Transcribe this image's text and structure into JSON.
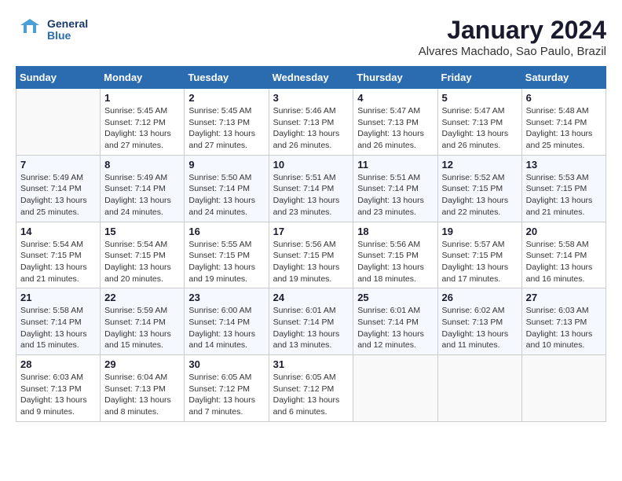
{
  "logo": {
    "line1": "General",
    "line2": "Blue"
  },
  "title": "January 2024",
  "location": "Alvares Machado, Sao Paulo, Brazil",
  "weekdays": [
    "Sunday",
    "Monday",
    "Tuesday",
    "Wednesday",
    "Thursday",
    "Friday",
    "Saturday"
  ],
  "weeks": [
    [
      {
        "day": "",
        "sunrise": "",
        "sunset": "",
        "daylight": ""
      },
      {
        "day": "1",
        "sunrise": "Sunrise: 5:45 AM",
        "sunset": "Sunset: 7:12 PM",
        "daylight": "Daylight: 13 hours and 27 minutes."
      },
      {
        "day": "2",
        "sunrise": "Sunrise: 5:45 AM",
        "sunset": "Sunset: 7:13 PM",
        "daylight": "Daylight: 13 hours and 27 minutes."
      },
      {
        "day": "3",
        "sunrise": "Sunrise: 5:46 AM",
        "sunset": "Sunset: 7:13 PM",
        "daylight": "Daylight: 13 hours and 26 minutes."
      },
      {
        "day": "4",
        "sunrise": "Sunrise: 5:47 AM",
        "sunset": "Sunset: 7:13 PM",
        "daylight": "Daylight: 13 hours and 26 minutes."
      },
      {
        "day": "5",
        "sunrise": "Sunrise: 5:47 AM",
        "sunset": "Sunset: 7:13 PM",
        "daylight": "Daylight: 13 hours and 26 minutes."
      },
      {
        "day": "6",
        "sunrise": "Sunrise: 5:48 AM",
        "sunset": "Sunset: 7:14 PM",
        "daylight": "Daylight: 13 hours and 25 minutes."
      }
    ],
    [
      {
        "day": "7",
        "sunrise": "Sunrise: 5:49 AM",
        "sunset": "Sunset: 7:14 PM",
        "daylight": "Daylight: 13 hours and 25 minutes."
      },
      {
        "day": "8",
        "sunrise": "Sunrise: 5:49 AM",
        "sunset": "Sunset: 7:14 PM",
        "daylight": "Daylight: 13 hours and 24 minutes."
      },
      {
        "day": "9",
        "sunrise": "Sunrise: 5:50 AM",
        "sunset": "Sunset: 7:14 PM",
        "daylight": "Daylight: 13 hours and 24 minutes."
      },
      {
        "day": "10",
        "sunrise": "Sunrise: 5:51 AM",
        "sunset": "Sunset: 7:14 PM",
        "daylight": "Daylight: 13 hours and 23 minutes."
      },
      {
        "day": "11",
        "sunrise": "Sunrise: 5:51 AM",
        "sunset": "Sunset: 7:14 PM",
        "daylight": "Daylight: 13 hours and 23 minutes."
      },
      {
        "day": "12",
        "sunrise": "Sunrise: 5:52 AM",
        "sunset": "Sunset: 7:15 PM",
        "daylight": "Daylight: 13 hours and 22 minutes."
      },
      {
        "day": "13",
        "sunrise": "Sunrise: 5:53 AM",
        "sunset": "Sunset: 7:15 PM",
        "daylight": "Daylight: 13 hours and 21 minutes."
      }
    ],
    [
      {
        "day": "14",
        "sunrise": "Sunrise: 5:54 AM",
        "sunset": "Sunset: 7:15 PM",
        "daylight": "Daylight: 13 hours and 21 minutes."
      },
      {
        "day": "15",
        "sunrise": "Sunrise: 5:54 AM",
        "sunset": "Sunset: 7:15 PM",
        "daylight": "Daylight: 13 hours and 20 minutes."
      },
      {
        "day": "16",
        "sunrise": "Sunrise: 5:55 AM",
        "sunset": "Sunset: 7:15 PM",
        "daylight": "Daylight: 13 hours and 19 minutes."
      },
      {
        "day": "17",
        "sunrise": "Sunrise: 5:56 AM",
        "sunset": "Sunset: 7:15 PM",
        "daylight": "Daylight: 13 hours and 19 minutes."
      },
      {
        "day": "18",
        "sunrise": "Sunrise: 5:56 AM",
        "sunset": "Sunset: 7:15 PM",
        "daylight": "Daylight: 13 hours and 18 minutes."
      },
      {
        "day": "19",
        "sunrise": "Sunrise: 5:57 AM",
        "sunset": "Sunset: 7:15 PM",
        "daylight": "Daylight: 13 hours and 17 minutes."
      },
      {
        "day": "20",
        "sunrise": "Sunrise: 5:58 AM",
        "sunset": "Sunset: 7:14 PM",
        "daylight": "Daylight: 13 hours and 16 minutes."
      }
    ],
    [
      {
        "day": "21",
        "sunrise": "Sunrise: 5:58 AM",
        "sunset": "Sunset: 7:14 PM",
        "daylight": "Daylight: 13 hours and 15 minutes."
      },
      {
        "day": "22",
        "sunrise": "Sunrise: 5:59 AM",
        "sunset": "Sunset: 7:14 PM",
        "daylight": "Daylight: 13 hours and 15 minutes."
      },
      {
        "day": "23",
        "sunrise": "Sunrise: 6:00 AM",
        "sunset": "Sunset: 7:14 PM",
        "daylight": "Daylight: 13 hours and 14 minutes."
      },
      {
        "day": "24",
        "sunrise": "Sunrise: 6:01 AM",
        "sunset": "Sunset: 7:14 PM",
        "daylight": "Daylight: 13 hours and 13 minutes."
      },
      {
        "day": "25",
        "sunrise": "Sunrise: 6:01 AM",
        "sunset": "Sunset: 7:14 PM",
        "daylight": "Daylight: 13 hours and 12 minutes."
      },
      {
        "day": "26",
        "sunrise": "Sunrise: 6:02 AM",
        "sunset": "Sunset: 7:13 PM",
        "daylight": "Daylight: 13 hours and 11 minutes."
      },
      {
        "day": "27",
        "sunrise": "Sunrise: 6:03 AM",
        "sunset": "Sunset: 7:13 PM",
        "daylight": "Daylight: 13 hours and 10 minutes."
      }
    ],
    [
      {
        "day": "28",
        "sunrise": "Sunrise: 6:03 AM",
        "sunset": "Sunset: 7:13 PM",
        "daylight": "Daylight: 13 hours and 9 minutes."
      },
      {
        "day": "29",
        "sunrise": "Sunrise: 6:04 AM",
        "sunset": "Sunset: 7:13 PM",
        "daylight": "Daylight: 13 hours and 8 minutes."
      },
      {
        "day": "30",
        "sunrise": "Sunrise: 6:05 AM",
        "sunset": "Sunset: 7:12 PM",
        "daylight": "Daylight: 13 hours and 7 minutes."
      },
      {
        "day": "31",
        "sunrise": "Sunrise: 6:05 AM",
        "sunset": "Sunset: 7:12 PM",
        "daylight": "Daylight: 13 hours and 6 minutes."
      },
      {
        "day": "",
        "sunrise": "",
        "sunset": "",
        "daylight": ""
      },
      {
        "day": "",
        "sunrise": "",
        "sunset": "",
        "daylight": ""
      },
      {
        "day": "",
        "sunrise": "",
        "sunset": "",
        "daylight": ""
      }
    ]
  ]
}
